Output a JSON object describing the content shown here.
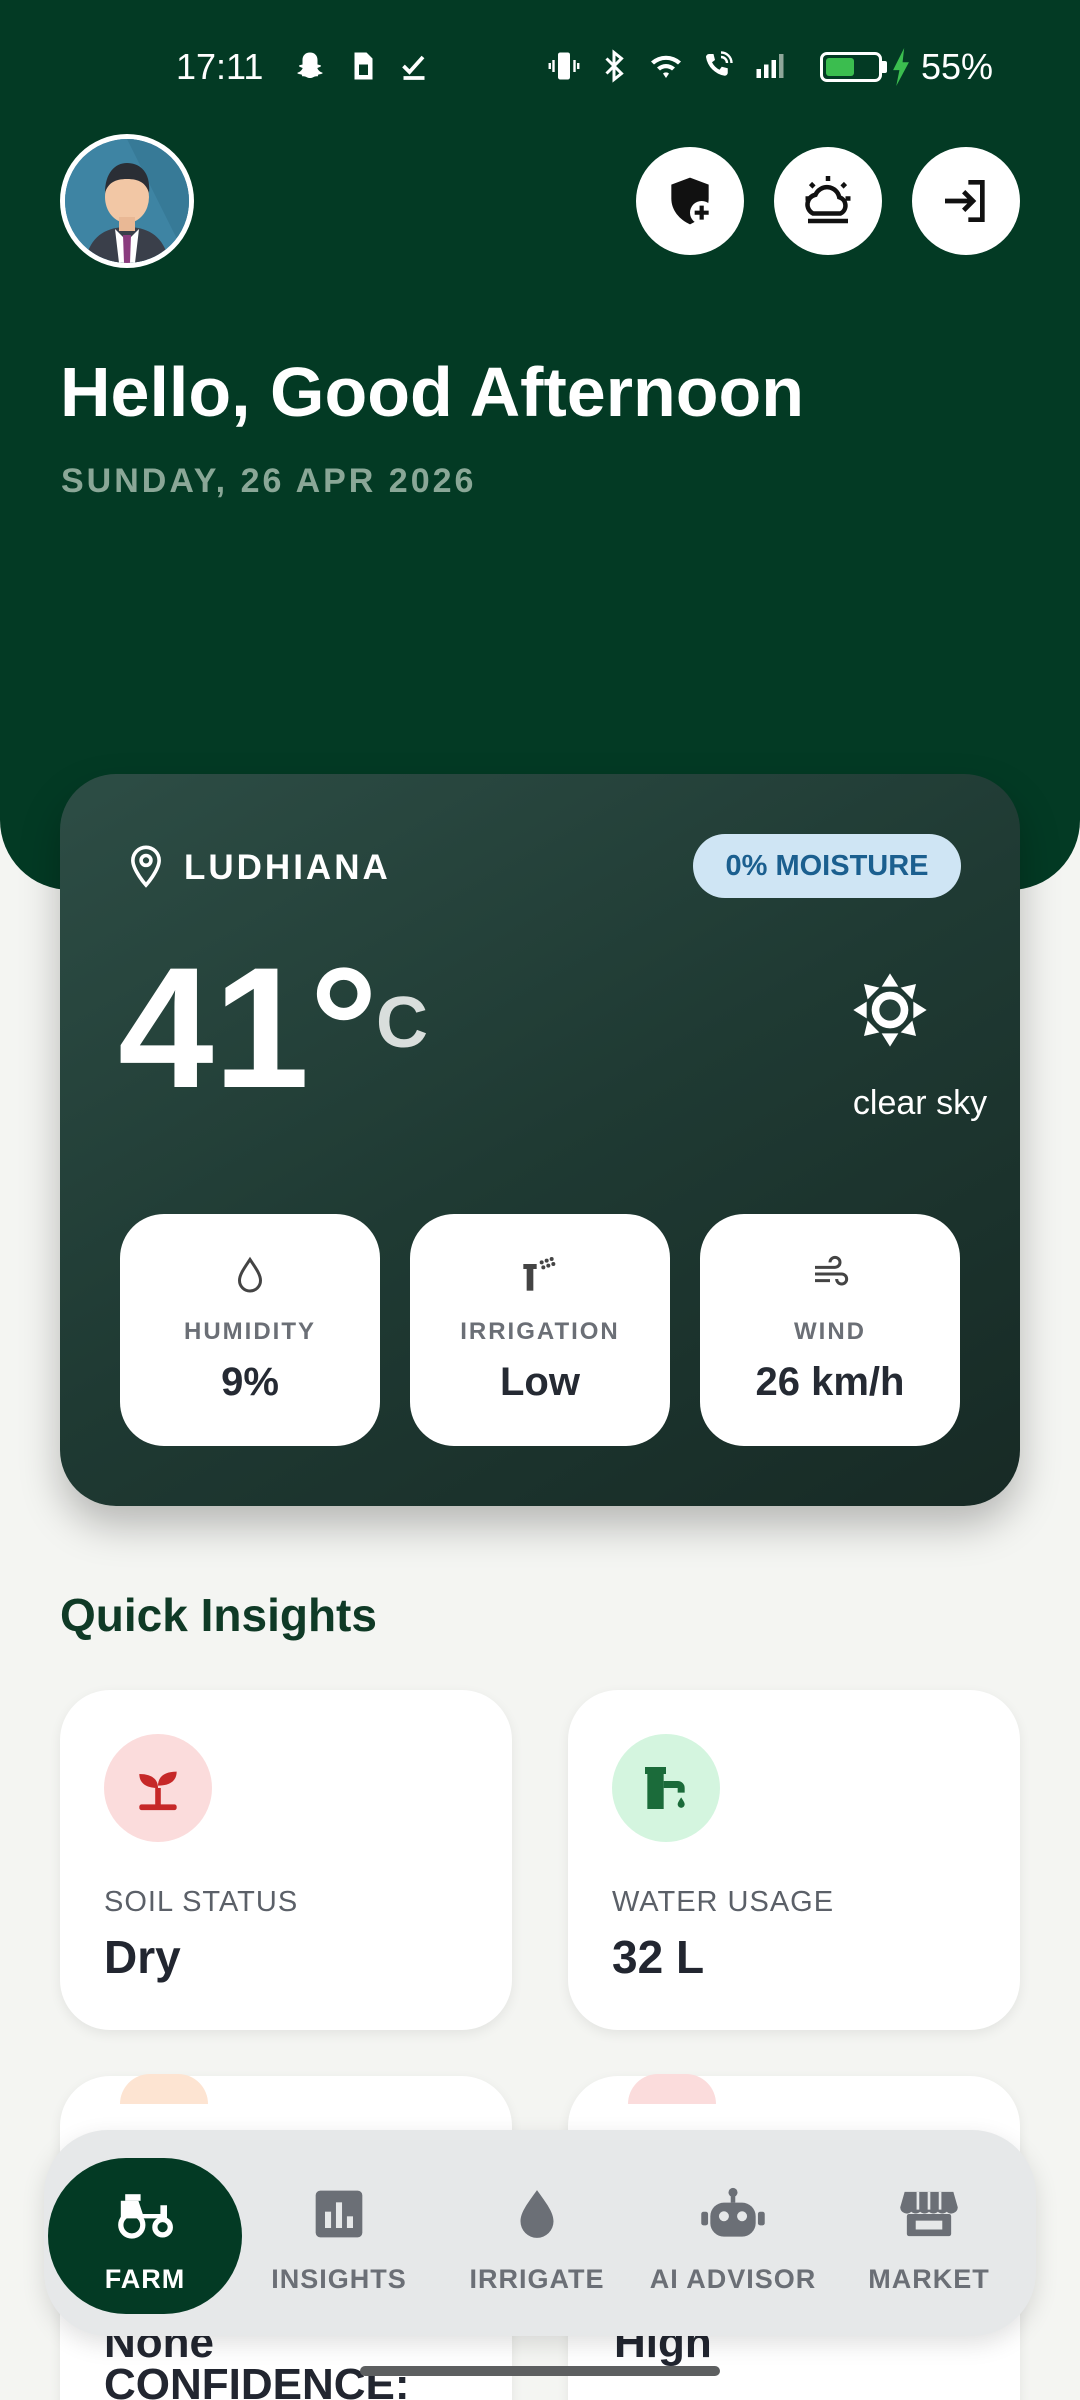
{
  "status_bar": {
    "time": "17:11",
    "battery_percent": "55%",
    "battery_level": 0.55,
    "left_icons": [
      "snapchat-icon",
      "sim-card-icon",
      "check-icon"
    ],
    "right_icons": [
      "vibrate-icon",
      "bluetooth-icon",
      "wifi-icon",
      "wifi-call-icon",
      "signal-icon"
    ]
  },
  "header": {
    "greeting": "Hello, Good Afternoon",
    "date": "SUNDAY, 26 APR 2026",
    "buttons": [
      "shield-add-icon",
      "weather-icon",
      "logout-icon"
    ]
  },
  "weather": {
    "location": "LUDHIANA",
    "moisture_badge": "0% MOISTURE",
    "temperature": "41°",
    "unit": "C",
    "condition": "clear sky",
    "stats": [
      {
        "label": "HUMIDITY",
        "value": "9%",
        "icon": "drop-icon"
      },
      {
        "label": "IRRIGATION",
        "value": "Low",
        "icon": "sprinkler-icon"
      },
      {
        "label": "WIND",
        "value": "26 km/h",
        "icon": "wind-icon"
      }
    ]
  },
  "insights": {
    "title": "Quick Insights",
    "cards": [
      {
        "label": "SOIL STATUS",
        "value": "Dry",
        "icon": "sprout-icon",
        "accent": "#c62828"
      },
      {
        "label": "WATER USAGE",
        "value": "32 L",
        "icon": "water-tap-icon",
        "accent": "#1b6b3a"
      }
    ],
    "partial": {
      "left_line1": "None",
      "left_line2": "CONFIDENCE:",
      "right_line1": "High"
    }
  },
  "nav": {
    "items": [
      {
        "label": "FARM",
        "icon": "tractor-icon"
      },
      {
        "label": "INSIGHTS",
        "icon": "bar-chart-icon"
      },
      {
        "label": "IRRIGATE",
        "icon": "drop-icon"
      },
      {
        "label": "AI ADVISOR",
        "icon": "robot-icon"
      },
      {
        "label": "MARKET",
        "icon": "store-icon"
      }
    ]
  },
  "colors": {
    "primary": "#033a24",
    "card_dark": "#1f3a33",
    "badge_bg": "#cfe5f4",
    "badge_text": "#1b5f8f"
  }
}
